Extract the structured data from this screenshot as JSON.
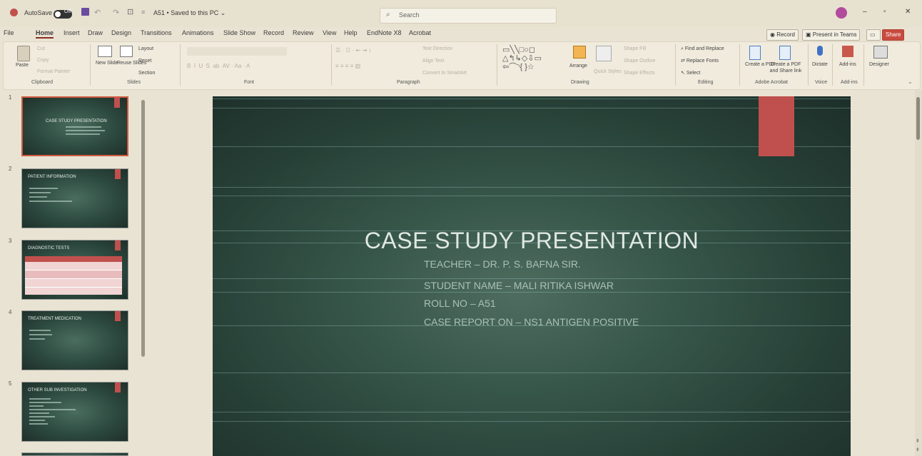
{
  "titlebar": {
    "autosave_label": "AutoSave",
    "autosave_state": "Off",
    "doc_title": "A51 • Saved to this PC ⌄",
    "search_placeholder": "Search",
    "accent": "#c0504d"
  },
  "menu": {
    "items": [
      "File",
      "Home",
      "Insert",
      "Draw",
      "Design",
      "Transitions",
      "Animations",
      "Slide Show",
      "Record",
      "Review",
      "View",
      "Help",
      "EndNote X8",
      "Acrobat"
    ],
    "active": "Home",
    "record_label": "Record",
    "present_label": "Present in Teams",
    "share_label": "Share"
  },
  "ribbon": {
    "clipboard": {
      "paste": "Paste",
      "cut": "Cut",
      "copy": "Copy",
      "format_painter": "Format Painter",
      "group": "Clipboard"
    },
    "slides": {
      "new_slide": "New Slide",
      "reuse_slides": "Reuse Slides",
      "layout": "Layout",
      "reset": "Reset",
      "section": "Section",
      "group": "Slides"
    },
    "font": {
      "group": "Font"
    },
    "paragraph": {
      "text_direction": "Text Direction",
      "align_text": "Align Text",
      "smartart": "Convert to SmartArt",
      "group": "Paragraph"
    },
    "drawing": {
      "arrange": "Arrange",
      "quick_styles": "Quick Styles",
      "shape_fill": "Shape Fill",
      "shape_outline": "Shape Outline",
      "shape_effects": "Shape Effects",
      "group": "Drawing"
    },
    "editing": {
      "find": "Find and Replace",
      "replace_fonts": "Replace Fonts",
      "select": "Select",
      "group": "Editing"
    },
    "adobe": {
      "create_pdf": "Create a PDF",
      "create_share": "Create a PDF and Share link",
      "group": "Adobe Acrobat"
    },
    "voice": {
      "dictate": "Dictate",
      "group": "Voice"
    },
    "addins": {
      "addins": "Add-ins",
      "group": "Add-ins"
    },
    "designer": {
      "label": "Designer"
    }
  },
  "thumbnails": [
    {
      "num": "1",
      "title": "CASE STUDY PRESENTATION"
    },
    {
      "num": "2",
      "title": "PATIENT INFORMATION"
    },
    {
      "num": "3",
      "title": "DIAGNOSTIC TESTS"
    },
    {
      "num": "4",
      "title": "TREATMENT MEDICATION"
    },
    {
      "num": "5",
      "title": "OTHER SUB INVESTIGATION"
    }
  ],
  "slide": {
    "title": "CASE STUDY PRESENTATION",
    "lines": [
      "TEACHER – DR. P. S. BAFNA SIR.",
      "STUDENT NAME – MALI RITIKA ISHWAR",
      "ROLL NO – A51",
      "CASE REPORT ON – NS1 ANTIGEN POSITIVE"
    ]
  }
}
